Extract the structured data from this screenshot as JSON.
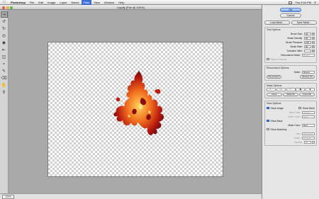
{
  "menubar": {
    "app": "Photoshop",
    "items": [
      "File",
      "Edit",
      "Image",
      "Layer",
      "Select",
      "Filter",
      "View",
      "Window",
      "Help"
    ],
    "active_index": 5,
    "clock": "Thu 9:54 PM"
  },
  "window": {
    "title": "Liquify (Fire @ 100%)"
  },
  "status": {
    "zoom": "100%"
  },
  "panel": {
    "ok": "OK",
    "cancel": "Cancel",
    "load_mesh": "Load Mesh...",
    "save_mesh": "Save Mesh...",
    "tool_options": {
      "title": "Tool Options",
      "brush_size_label": "Brush Size:",
      "brush_size": "64",
      "brush_density_label": "Brush Density:",
      "brush_density": "50",
      "brush_pressure_label": "Brush Pressure:",
      "brush_pressure": "100",
      "brush_rate_label": "Brush Rate:",
      "brush_rate": "80",
      "turbulent_jitter_label": "Turbulent Jitter:",
      "turbulent_jitter": "",
      "reconstruct_mode_label": "Reconstruct Mode:",
      "reconstruct_mode": "Revert",
      "stylus_label": "Stylus Pressure"
    },
    "reconstruct_options": {
      "title": "Reconstruct Options",
      "mode_label": "Mode:",
      "mode": "Revert",
      "reconstruct_btn": "Reconstruct",
      "restore_all_btn": "Restore All"
    },
    "mask_options": {
      "title": "Mask Options",
      "none_btn": "None",
      "mask_all_btn": "Mask All",
      "invert_all_btn": "Invert All"
    },
    "view_options": {
      "title": "View Options",
      "show_image": "Show Image",
      "show_mesh": "Show Mesh",
      "mesh_size_label": "Mesh Size:",
      "mesh_size": "Medium",
      "mesh_color_label": "Mesh Color:",
      "mesh_color": "Gray",
      "show_mask": "Show Mask",
      "mask_color_label": "Mask Color:",
      "mask_color": "Red",
      "show_backdrop": "Show Backdrop",
      "use_label": "Use:",
      "use": "All Layers",
      "mode_label": "Mode:",
      "mode": "In Front",
      "opacity_label": "Opacity:",
      "opacity": "50"
    }
  },
  "colors": {
    "accent": "#3d6fd6",
    "fire_dark": "#7a0d0d",
    "fire_mid": "#d7361c",
    "fire_bright": "#ffb52e"
  }
}
